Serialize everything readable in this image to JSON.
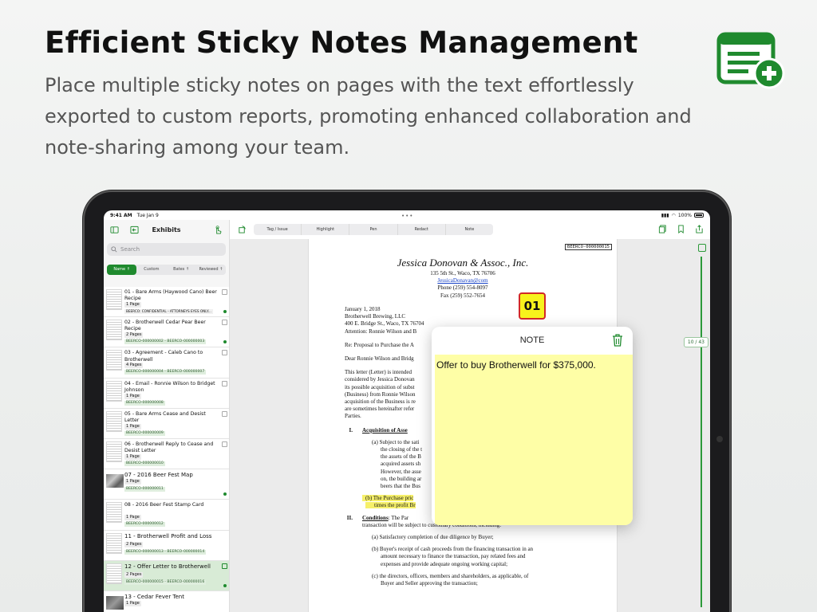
{
  "headline": "Efficient Sticky Notes Management",
  "subtext": "Place multiple sticky notes on pages with the text effortlessly exported to custom reports, promoting enhanced collaboration and note-sharing among your team.",
  "status": {
    "time": "9:41 AM",
    "date": "Tue Jan 9",
    "battery": "100%"
  },
  "sidebar": {
    "title": "Exhibits",
    "search_placeholder": "Search",
    "sort_tabs": [
      "Name ↑",
      "Custom",
      "Bates ↑",
      "Reviewed ↑"
    ],
    "items": [
      {
        "name": "01 - Bare Arms (Haywood Cano) Beer Recipe",
        "pages": "1 Page",
        "bates": "BEERCO: CONFIDENTIAL - ATTORNEYS EYES ONLY...",
        "dot": true
      },
      {
        "name": "02 - Brotherwell Cedar Pear Beer Recipe",
        "pages": "2 Pages",
        "bates": "BEERCO-000000002 - BEERCO-000000003",
        "dot": true
      },
      {
        "name": "03 - Agreement - Caleb Cano to Brotherwell",
        "pages": "4 Pages",
        "bates": "BEERCO-000000004 - BEERCO-000000007",
        "dot": false
      },
      {
        "name": "04 - Email - Ronnie Wilson to Bridget Johnson",
        "pages": "1 Page",
        "bates": "BEERCO-000000008",
        "dot": false
      },
      {
        "name": "05 - Bare Arms Cease and Desist Letter",
        "pages": "1 Page",
        "bates": "BEERCO-000000009",
        "dot": false
      },
      {
        "name": "06 - Brotherwell Reply to Cease and Desist Letter",
        "pages": "1 Page",
        "bates": "BEERCO-000000010",
        "dot": false
      },
      {
        "name": "07 - 2016 Beer Fest Map",
        "pages": "1 Page",
        "bates": "BEERCO-000000011",
        "dot": true
      },
      {
        "name": "08 - 2016 Beer Fest Stamp Card",
        "pages": "1 Page",
        "bates": "BEERCO-000000012",
        "dot": false
      },
      {
        "name": "11 - Brotherwell Profit and Loss",
        "pages": "2 Pages",
        "bates": "BEERCO-000000013 - BEERCO-000000014",
        "dot": false
      },
      {
        "name": "12 - Offer Letter to Brotherwell",
        "pages": "2 Pages",
        "bates": "BEERCO-000000015 - BEERCO-000000016",
        "dot": true
      },
      {
        "name": "13 - Cedar Fever Tent",
        "pages": "1 Page",
        "bates": "",
        "dot": false
      }
    ]
  },
  "toolbar": {
    "tools": [
      "Tag / Issue",
      "Highlight",
      "Pen",
      "Redact",
      "Note"
    ]
  },
  "document": {
    "bates_stamp": "BEERCO-000000015",
    "firm": "Jessica Donovan & Assoc., Inc.",
    "address1": "135 5th St., Waco, TX 76706",
    "email": "JessicaDonavan@com",
    "phone": "Phone (259) 554-8097",
    "fax": "Fax (259) 552-7654",
    "date": "January 1, 2018",
    "recipient1": "Brotherwell Brewing, LLC",
    "recipient2": "400 E. Bridge St., Waco, TX 76704",
    "recipient3": "Attention: Ronnie Wilson and B",
    "re": "Re: Proposal to Purchase the A",
    "salutation": "Dear Ronnie Wilson and Bridg",
    "para1_l1": "This letter (Letter) is intended",
    "para1_l2": "considered by Jessica Donovan",
    "para1_l3": "its possible acquisition of subst",
    "para1_l4": "(Business) from Ronnie Wilson",
    "para1_l5": "acquisition of the Business is re",
    "para1_l6": "are sometimes hereinafter refer",
    "para1_l7": "Parties.",
    "sec1_num": "I.",
    "sec1_title": "Acquisition of Asse",
    "sec1a_l1": "(a) Subject to the sati",
    "sec1a_l2": "the closing of the t",
    "sec1a_l3": "the assets of the B",
    "sec1a_l4": "acquired assets sh",
    "sec1a_l5": "However, the asse",
    "sec1a_l6": "on, the building ar",
    "sec1a_l7": "beers that the Bus",
    "sec1b_l1": "(b) The Purchase pric",
    "sec1b_l2": "times the profit Br",
    "sec2_num": "II.",
    "sec2_title": "Conditions",
    "sec2_l1": ": The Par",
    "sec2_l2": "transaction will be subject to customary conditions, including:",
    "sec2a": "(a) Satisfactory completion of due diligence by Buyer;",
    "sec2b_l1": "(b) Buyer's receipt of cash proceeds from the financing transaction in an",
    "sec2b_l2": "amount necessary to finance the transaction, pay related fees and",
    "sec2b_l3": "expenses and provide adequate ongoing working capital;",
    "sec2c_l1": "(c) the directors, officers, members and shareholders, as applicable, of",
    "sec2c_l2": "Buyer and Seller approving the transaction;",
    "page_indicator": "10 / 43"
  },
  "note": {
    "marker": "01",
    "header": "NOTE",
    "text": "Offer to buy Brotherwell for $375,000.",
    "color": "#fefea6"
  },
  "colors": {
    "accent": "#1f8a2e",
    "highlight": "#f6f06a",
    "marker_border": "#d12828"
  }
}
